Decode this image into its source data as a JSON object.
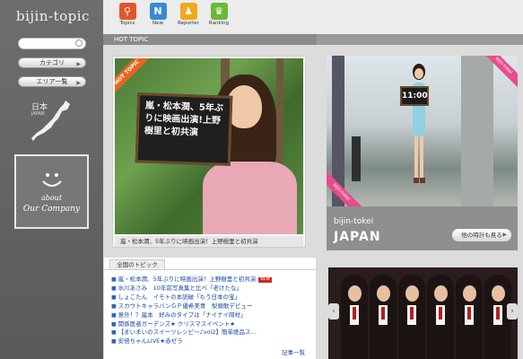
{
  "sidebar": {
    "logo": "bijin-topic",
    "search_placeholder": "",
    "category_label": "カテゴリ",
    "area_label": "エリア一覧",
    "japan_label": "日本",
    "japan_sub": "JAPAN",
    "about_line1": "about",
    "about_line2": "Our Company"
  },
  "nav": {
    "items": [
      {
        "label": "Topics",
        "icon": "magnifier-icon",
        "color": "#e2572a",
        "glyph": "⚲"
      },
      {
        "label": "New",
        "icon": "new-icon",
        "color": "#3a8ad6",
        "glyph": "N"
      },
      {
        "label": "Reporter",
        "icon": "reporter-icon",
        "color": "#f0a81c",
        "glyph": "♟"
      },
      {
        "label": "Ranking",
        "icon": "crown-icon",
        "color": "#6ab83a",
        "glyph": "♛"
      }
    ]
  },
  "hot_topic": {
    "header": "HOT TOPIC",
    "ribbon": "HOT TOPIC",
    "board_text": "嵐・松本潤、5年ぶりに映画出演!上野樹里と初共演",
    "caption": "嵐・松本潤、5年ぶりに映画出演！上野樹里と初共演"
  },
  "tokei": {
    "title": "bijin-tokei",
    "region": "JAPAN",
    "time": "11:00",
    "button": "他の時計も見る",
    "badge": "bijin-tokei",
    "badge2": "bijin-tokei"
  },
  "news": {
    "tab": "全国のトピック",
    "items": [
      "嵐・松本潤、5年ぶりに映画出演！上野樹里と初共演",
      "水川あさみ　10年前写真集と比べ「老けたな」",
      "しょこたん　イモトの本読破「もう日本の宝」",
      "スカウトキャラバンＧＰ優希美青　梨頭歌デビュー",
      "意外！？嵐本　好みのタイプは「ナイナイ岡村」",
      "関係医者ガーデンズ★ クリスマスイベント★",
      "【まいまいのスイーツレシピ～♪vol2】簡単絶品ス…",
      "安倍ちゃんLIVE★赤ゼラ"
    ],
    "new_badge": "NEW",
    "more": "記事一覧"
  },
  "group": {
    "prev": "‹",
    "next": "›"
  }
}
